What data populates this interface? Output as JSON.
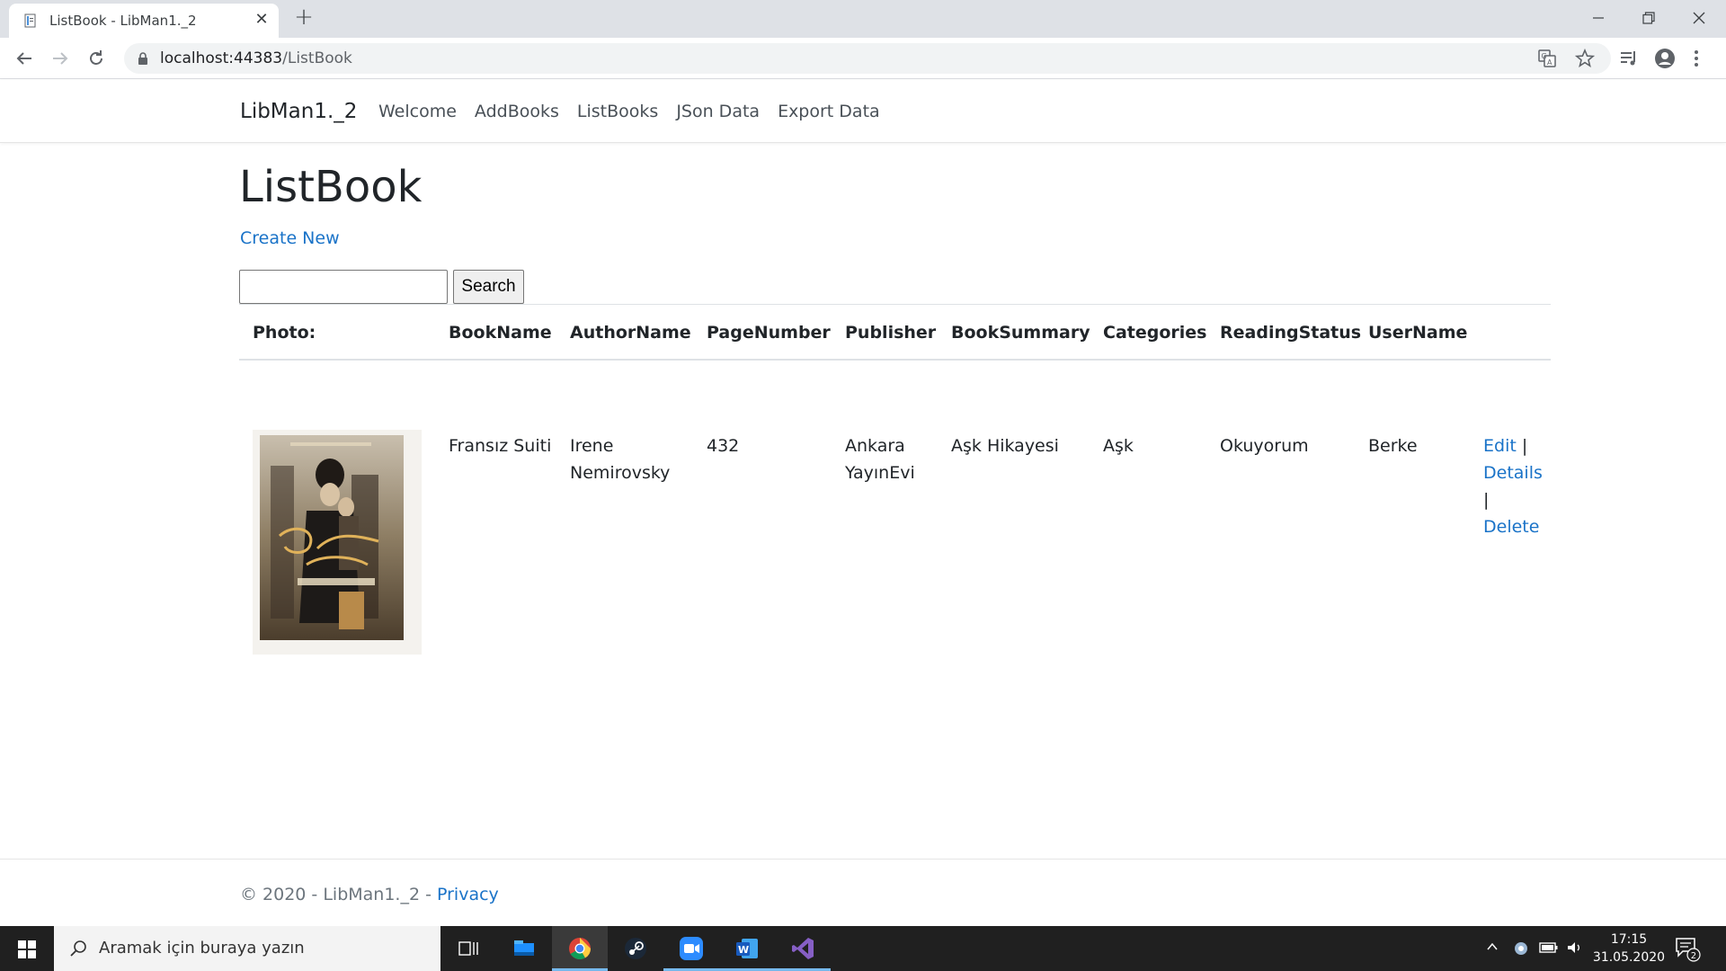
{
  "browser": {
    "tab_title": "ListBook - LibMan1._2",
    "url_host": "localhost:44383",
    "url_path": "/ListBook"
  },
  "site": {
    "brand": "LibMan1._2",
    "nav": [
      "Welcome",
      "AddBooks",
      "ListBooks",
      "JSon Data",
      "Export Data"
    ]
  },
  "page": {
    "title": "ListBook",
    "create_new": "Create New",
    "search_value": "",
    "search_button": "Search"
  },
  "table": {
    "headers": [
      "Photo:",
      "BookName",
      "AuthorName",
      "PageNumber",
      "Publisher",
      "BookSummary",
      "Categories",
      "ReadingStatus",
      "UserName"
    ],
    "rows": [
      {
        "photo_alt": "Fransız Suiti cover",
        "book_name": "Fransız Suiti",
        "author_line1": "Irene",
        "author_line2": "Nemirovsky",
        "page_number": "432",
        "publisher_line1": "Ankara",
        "publisher_line2": "YayınEvi",
        "summary": "Aşk Hikayesi",
        "category": "Aşk",
        "reading_status": "Okuyorum",
        "user_name": "Berke",
        "actions": {
          "edit": "Edit",
          "details": "Details",
          "delete": "Delete",
          "separator": "|"
        }
      }
    ]
  },
  "footer": {
    "text": "© 2020 - LibMan1._2 - ",
    "privacy": "Privacy"
  },
  "taskbar": {
    "search_placeholder": "Aramak için buraya yazın",
    "time": "17:15",
    "date": "31.05.2020",
    "notifications": "2"
  }
}
